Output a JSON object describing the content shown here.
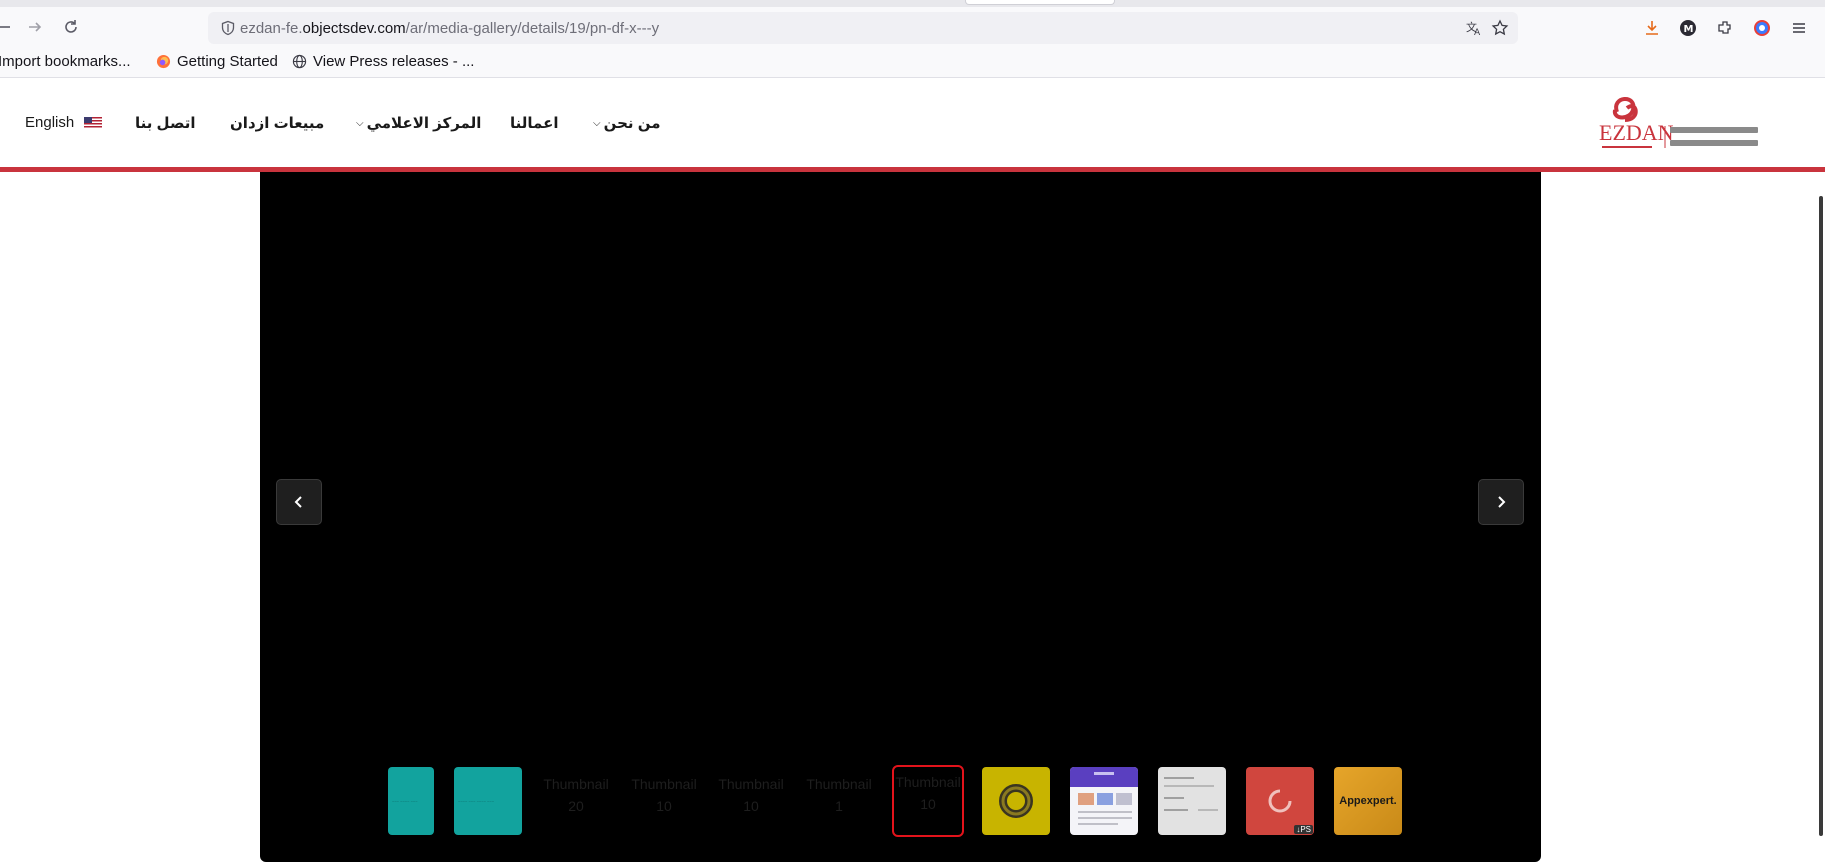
{
  "browser": {
    "url_host_prefix": "ezdan-fe.",
    "url_domain": "objectsdev.com",
    "url_path": "/ar/media-gallery/details/19/pn-df-x---y",
    "bookmarks": [
      {
        "label": "Import bookmarks..."
      },
      {
        "label": "Getting Started"
      },
      {
        "label": "View Press releases - ..."
      }
    ]
  },
  "header": {
    "nav": {
      "about": "من نحن",
      "projects": "اعمالنا",
      "media_center": "المركز الاعلامي",
      "sales": "مبيعات ازدان",
      "contact": "اتصل بنا"
    },
    "language": "English"
  },
  "gallery": {
    "thumbnails": [
      {
        "kind": "teal-partial"
      },
      {
        "kind": "teal"
      },
      {
        "kind": "ghost",
        "label": "Thumbnail",
        "num": "20"
      },
      {
        "kind": "ghost",
        "label": "Thumbnail",
        "num": "10"
      },
      {
        "kind": "ghost",
        "label": "Thumbnail",
        "num": "10"
      },
      {
        "kind": "ghost",
        "label": "Thumbnail",
        "num": "1"
      },
      {
        "kind": "active",
        "label": "Thumbnail",
        "num": "10"
      },
      {
        "kind": "yellow"
      },
      {
        "kind": "mock"
      },
      {
        "kind": "grey"
      },
      {
        "kind": "red",
        "badge": "↓PS"
      },
      {
        "kind": "orange",
        "label": "Appexpert."
      }
    ]
  },
  "colors": {
    "brand_red": "#c9343d",
    "active_thumb_border": "#e3131b",
    "viewer_bg": "#000000"
  }
}
